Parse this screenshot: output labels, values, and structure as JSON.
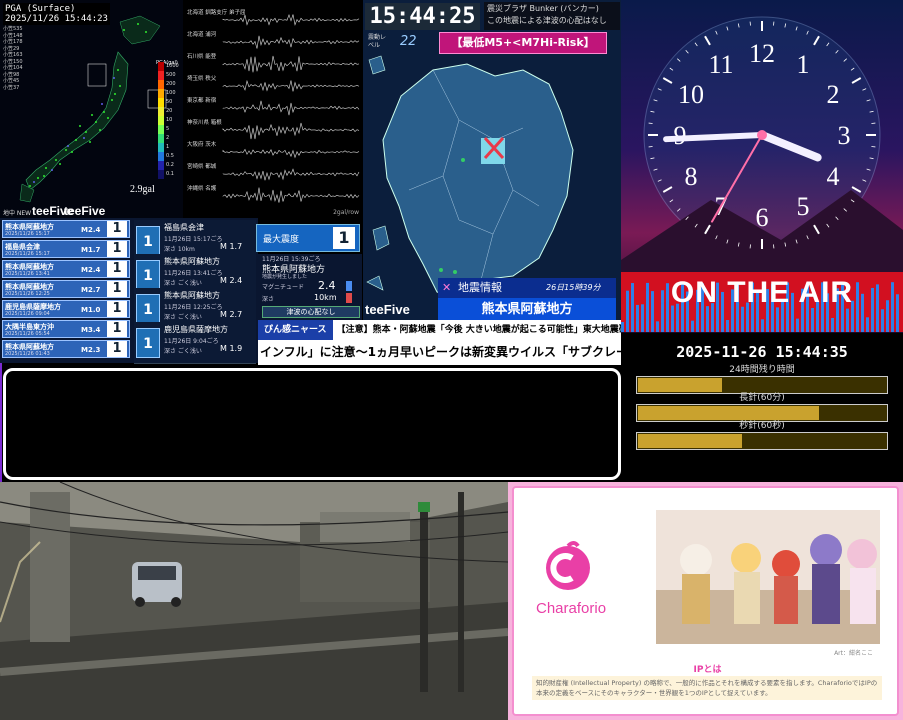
{
  "pga": {
    "title": "PGA (Surface)",
    "timestamp": "2025/11/26 15:44:23",
    "legend": [
      "小笠535",
      "小笠148",
      "小笠178",
      "小笠29",
      "小笠163",
      "小笠150",
      "小笠104",
      "小笠98",
      "小笠45",
      "小笠37"
    ],
    "scale_title": "PGA(gal)",
    "scale_ticks": [
      "1000",
      "500",
      "200",
      "100",
      "50",
      "20",
      "10",
      "5",
      "2",
      "1",
      "0.5",
      "0.2",
      "0.1"
    ],
    "peak": "2.9gal",
    "brand": "teeFive"
  },
  "seismo": {
    "stations": [
      "北海道 釧路支庁 弟子屈",
      "北海道 浦河",
      "石川県 能登",
      "埼玉県 秩父",
      "東京都 新宿",
      "神奈川県 箱根",
      "大阪府 茨木",
      "宮崎県 都城",
      "沖縄県 名護"
    ],
    "unit": "2gal/row"
  },
  "list": {
    "rows": [
      {
        "name": "熊本県阿蘇地方",
        "time": "2025/11/26 15:17",
        "mag": "M2.4",
        "intensity": "1"
      },
      {
        "name": "福島県会津",
        "time": "2025/11/26 15:17",
        "mag": "M1.7",
        "intensity": "1"
      },
      {
        "name": "熊本県阿蘇地方",
        "time": "2025/11/26 13:41",
        "mag": "M2.4",
        "intensity": "1"
      },
      {
        "name": "熊本県阿蘇地方",
        "time": "2025/11/26 12:25",
        "mag": "M2.7",
        "intensity": "1"
      },
      {
        "name": "鹿児島県薩摩地方",
        "time": "2025/11/26 09:04",
        "mag": "M1.0",
        "intensity": "1"
      },
      {
        "name": "大隅半島東方沖",
        "time": "2025/11/26 05:54",
        "mag": "M3.4",
        "intensity": "1"
      },
      {
        "name": "熊本県阿蘇地方",
        "time": "2025/11/26 01:43",
        "mag": "M2.3",
        "intensity": "1"
      }
    ],
    "cards": [
      {
        "name": "福島県会津",
        "time": "11月26日 15:17ごろ",
        "depth": "深さ 10km",
        "mag": "M 1.7",
        "intensity": "1"
      },
      {
        "name": "熊本県阿蘇地方",
        "time": "11月26日 13:41ごろ",
        "depth": "深さ ごく浅い",
        "mag": "M 2.4",
        "intensity": "1"
      },
      {
        "name": "熊本県阿蘇地方",
        "time": "11月26日 12:25ごろ",
        "depth": "深さ ごく浅い",
        "mag": "M 2.7",
        "intensity": "1"
      },
      {
        "name": "鹿児島県薩摩地方",
        "time": "11月26日 9:04ごろ",
        "depth": "深さ ごく浅い",
        "mag": "M 1.9",
        "intensity": "1"
      }
    ],
    "max_label": "最大震度",
    "max_value": "1",
    "detail_time": "11月26日 15:39ごろ",
    "detail_place": "熊本県阿蘇地方",
    "detail_note": "地震が発生しました",
    "mag_label": "マグニチュード",
    "mag_value": "2.4",
    "depth_label": "深さ",
    "depth_value": "10km",
    "tsunami": "津波の心配なし",
    "small_label": "地中 NEW",
    "small_brand": "teeFive"
  },
  "map": {
    "time": "15:44:25",
    "bunker_title": "震災ブラザ Bunker (バンカー)",
    "bunker_msg": "この地震による津波の心配はなし",
    "level_label": "震動レベル",
    "level_value": "22",
    "risk_label": "【最低M5+<M7Hi-Risk】",
    "eq_info_title": "地震情報",
    "eq_info_date": "26日15時39分",
    "eq_info_place": "熊本県阿蘇地方",
    "brand": "teeFive"
  },
  "ticker": {
    "tag": "ぴん感ニャース",
    "line1": "【注意】熊本・阿蘇地震「今後 大きい地震が起こる可能性」東大地震研・笠原教授",
    "line2": "インフル」に注意〜1ヵ月早いピークは新変異ウイルス「サブクレード"
  },
  "clock": {
    "numerals": [
      "12",
      "1",
      "2",
      "3",
      "4",
      "5",
      "6",
      "7",
      "8",
      "9",
      "10",
      "11"
    ],
    "on_air": "ON THE AIR",
    "datetime": "2025-11-26 15:44:35",
    "bars": [
      {
        "label": "24時間残り時間",
        "fill": 0.34
      },
      {
        "label": "長針(60分)",
        "fill": 0.73
      },
      {
        "label": "秒針(60秒)",
        "fill": 0.42
      }
    ],
    "accent": "#c9a22e"
  },
  "chara": {
    "name": "Charaforio",
    "credit": "Art：紺名ここ",
    "ip_title": "IPとは",
    "desc": "知的財産権 (Intellectual Property) の略称で、一般的に作品とそれを構成する要素を指します。CharaforioではIPの本来の定義をベースにそのキャラクター・世界観を1つのIPとして捉えています。",
    "brand_color": "#e93fa6"
  }
}
